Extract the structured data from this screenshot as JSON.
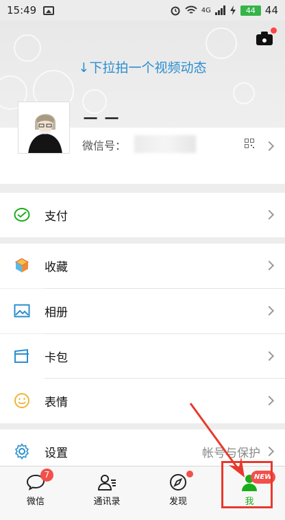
{
  "status_bar": {
    "time": "15:49",
    "battery": "44",
    "network": "4G",
    "right_number": "44"
  },
  "header": {
    "pull_hint": "↓下拉拍一个视频动态"
  },
  "profile": {
    "nickname": "一 一",
    "wechat_id_label": "微信号："
  },
  "menu": {
    "pay": "支付",
    "favorites": "收藏",
    "album": "相册",
    "card_wallet": "卡包",
    "stickers": "表情",
    "settings": "设置",
    "settings_sub": "帐号与保护"
  },
  "tabbar": {
    "chats": "微信",
    "chats_badge": "7",
    "contacts": "通讯录",
    "discover": "发现",
    "me": "我",
    "me_badge": "NEW"
  },
  "colors": {
    "accent_green": "#1aad19",
    "link_blue": "#2a8ecf",
    "badge_red": "#f3504b",
    "annotation_red": "#e8392c"
  }
}
